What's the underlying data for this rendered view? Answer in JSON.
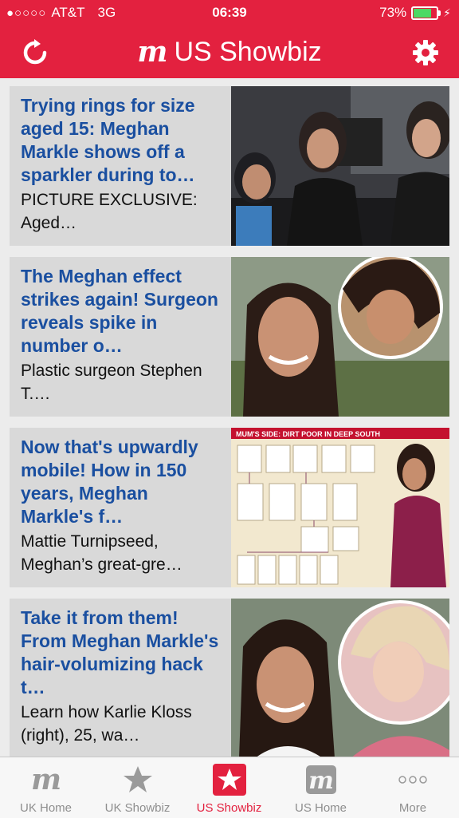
{
  "status": {
    "carrier": "AT&T",
    "network": "3G",
    "time": "06:39",
    "battery": "73%",
    "battery_level": 0.73
  },
  "header": {
    "logo_glyph": "m",
    "title": "US Showbiz",
    "refresh_icon": "refresh-icon",
    "settings_icon": "gear-icon",
    "color": "#e3213f"
  },
  "articles": [
    {
      "headline": "Trying rings for size aged 15: Meghan Markle shows off a sparkler during to…",
      "summary": "PICTURE EXCLUSIVE: Aged…"
    },
    {
      "headline": "The Meghan effect strikes again! Surgeon reveals spike in number o…",
      "summary": "Plastic surgeon Stephen T.…"
    },
    {
      "headline": "Now that's upwardly mobile! How in 150 years, Meghan Markle's f…",
      "summary": "Mattie Turnipseed, Meghan’s great-gre…",
      "image_caption": "MUM'S SIDE: DIRT POOR IN DEEP SOUTH"
    },
    {
      "headline": "Take it from them! From Meghan Markle's hair-volumizing hack t…",
      "summary": "Learn how Karlie Kloss (right), 25, wa…"
    }
  ],
  "tabs": [
    {
      "label": "UK Home",
      "icon": "m-logo-icon",
      "active": false
    },
    {
      "label": "UK Showbiz",
      "icon": "star-icon",
      "active": false
    },
    {
      "label": "US Showbiz",
      "icon": "star-icon",
      "active": true
    },
    {
      "label": "US Home",
      "icon": "m-logo-icon",
      "active": false
    },
    {
      "label": "More",
      "icon": "more-dots-icon",
      "active": false
    }
  ]
}
